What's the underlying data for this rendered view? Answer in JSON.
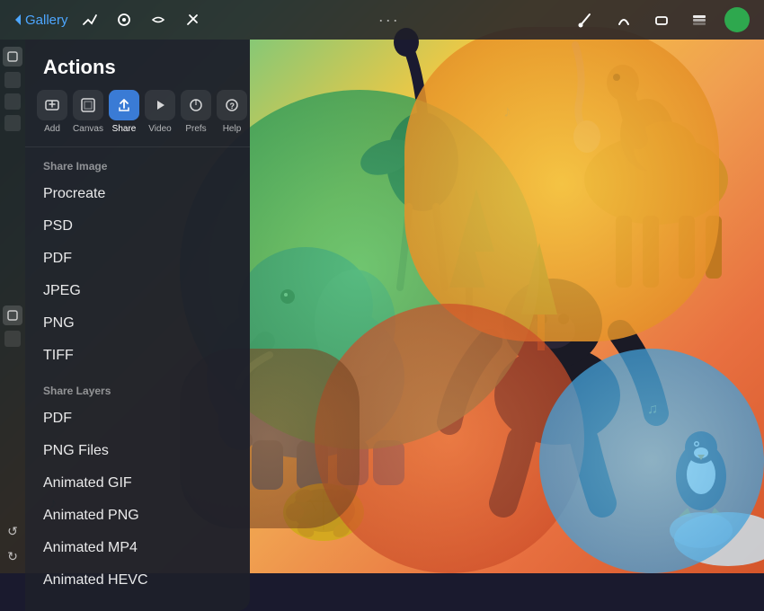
{
  "app": {
    "title": "Gallery",
    "dotMenu": "···"
  },
  "topBar": {
    "gallery_label": "Gallery",
    "tools": [
      {
        "name": "modify-icon",
        "label": "modify"
      },
      {
        "name": "paint-icon",
        "label": "paint"
      },
      {
        "name": "smudge-icon",
        "label": "smudge"
      },
      {
        "name": "erase-icon",
        "label": "erase"
      }
    ],
    "right_tools": [
      {
        "name": "brush-icon"
      },
      {
        "name": "smear-icon"
      },
      {
        "name": "eraser-icon"
      },
      {
        "name": "layers-icon"
      }
    ]
  },
  "actionsPanel": {
    "title": "Actions",
    "toolbar": [
      {
        "id": "add",
        "label": "Add",
        "icon": "+"
      },
      {
        "id": "canvas",
        "label": "Canvas",
        "icon": "⊞"
      },
      {
        "id": "share",
        "label": "Share",
        "icon": "↑",
        "active": true
      },
      {
        "id": "video",
        "label": "Video",
        "icon": "▶"
      },
      {
        "id": "prefs",
        "label": "Prefs",
        "icon": "◑"
      },
      {
        "id": "help",
        "label": "Help",
        "icon": "?"
      }
    ],
    "sections": [
      {
        "header": "Share Image",
        "items": [
          "Procreate",
          "PSD",
          "PDF",
          "JPEG",
          "PNG",
          "TIFF"
        ]
      },
      {
        "header": "Share Layers",
        "items": [
          "PDF",
          "PNG Files",
          "Animated GIF",
          "Animated PNG",
          "Animated MP4",
          "Animated HEVC"
        ]
      }
    ]
  }
}
